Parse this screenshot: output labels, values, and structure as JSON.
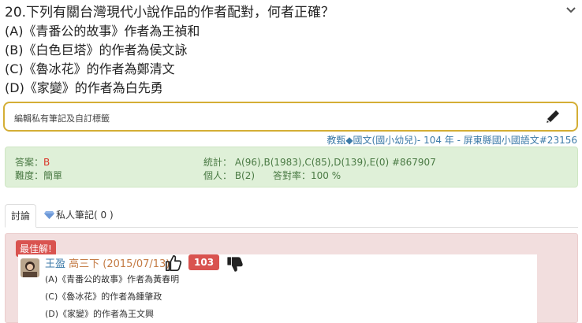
{
  "question": {
    "title": "20.下列有關台灣現代小說作品的作者配對，何者正確？",
    "options": [
      "(A)《青番公的故事》作者為王禎和",
      "(B)《白色巨塔》的作者為侯文詠",
      "(C)《魯冰花》的作者為鄭清文",
      "(D)《家變》的作者為白先勇"
    ]
  },
  "note": {
    "placeholder": "編輯私有筆記及自訂標籤"
  },
  "meta": {
    "category": "教甄◆國文(國小幼兒)",
    "detail": "104 年 - 屏東縣國小國語文#23156"
  },
  "stats": {
    "answer_label": "答案：",
    "answer_value": "B",
    "difficulty": "難度：簡單",
    "stats_line": "統計： A(96),B(1983),C(85),D(139),E(0) #867907",
    "personal": "個人： B(2)",
    "correct_rate": "答對率：100 %"
  },
  "tabs": {
    "discuss": "討論",
    "notes": "私人筆記( 0 )"
  },
  "best_answer": {
    "badge": "最佳解!",
    "author": "王盈",
    "author_meta": "高三下 (2015/07/13)",
    "likes": "103",
    "lines": [
      "(A)《青番公的故事》作者為黃春明",
      "(C)《魯冰花》的作者為鍾肇政",
      "(D)《家變》的作者為王文興"
    ]
  },
  "colors": {
    "accent_gold": "#d4ae35",
    "link_blue": "#3c7aa8",
    "stats_bg": "#dff0d8",
    "answer_bg": "#f2dede",
    "badge_red": "#d9534f"
  }
}
